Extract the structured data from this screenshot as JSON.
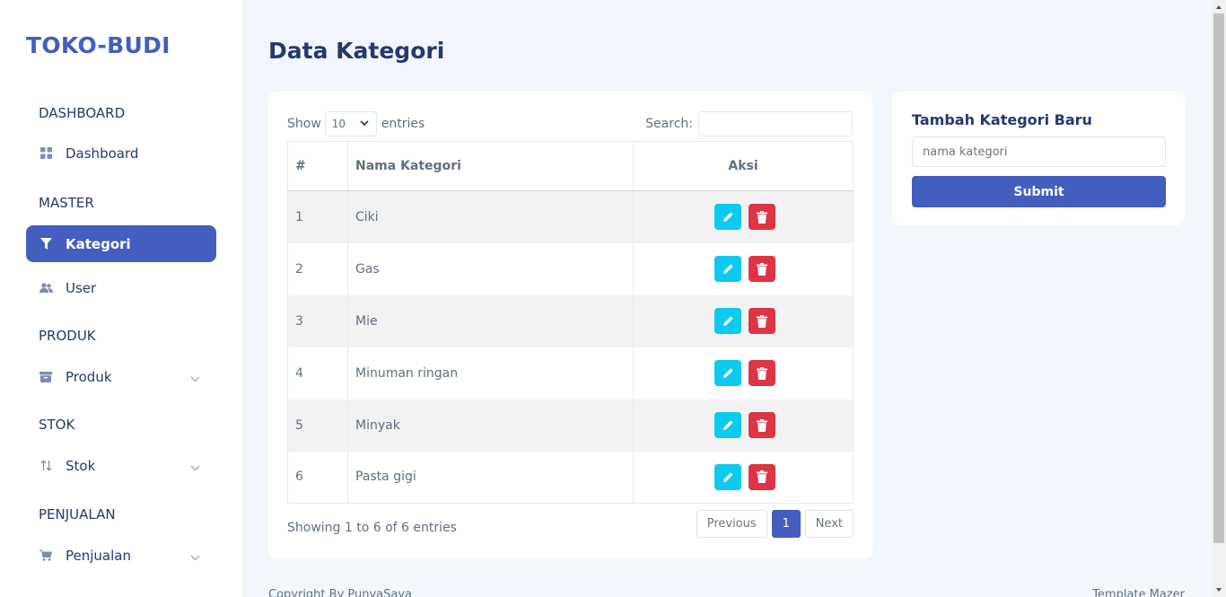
{
  "brand": "TOKO-BUDI",
  "page_title": "Data Kategori",
  "sidebar": {
    "sections": [
      {
        "title": "DASHBOARD"
      },
      {
        "title": "MASTER"
      },
      {
        "title": "PRODUK"
      },
      {
        "title": "STOK"
      },
      {
        "title": "PENJUALAN"
      }
    ],
    "items": [
      {
        "label": "Dashboard",
        "icon": "grid-icon",
        "active": false
      },
      {
        "label": "Kategori",
        "icon": "filter-icon",
        "active": true
      },
      {
        "label": "User",
        "icon": "users-icon",
        "active": false
      },
      {
        "label": "Produk",
        "icon": "archive-icon",
        "active": false,
        "has_submenu": true
      },
      {
        "label": "Stok",
        "icon": "sort-arrows-icon",
        "active": false,
        "has_submenu": true
      },
      {
        "label": "Penjualan",
        "icon": "cart-icon",
        "active": false,
        "has_submenu": true
      }
    ]
  },
  "table": {
    "show_label": "Show",
    "entries_value": "10",
    "entries_label": "entries",
    "search_label": "Search:",
    "columns": [
      "#",
      "Nama Kategori",
      "Aksi"
    ],
    "rows": [
      {
        "no": "1",
        "nama": "Ciki"
      },
      {
        "no": "2",
        "nama": "Gas"
      },
      {
        "no": "3",
        "nama": "Mie"
      },
      {
        "no": "4",
        "nama": "Minuman ringan"
      },
      {
        "no": "5",
        "nama": "Minyak"
      },
      {
        "no": "6",
        "nama": "Pasta gigi"
      }
    ],
    "info": "Showing 1 to 6 of 6 entries",
    "pagination": {
      "previous": "Previous",
      "current": "1",
      "next": "Next"
    }
  },
  "form": {
    "title": "Tambah Kategori Baru",
    "placeholder": "nama kategori",
    "submit_label": "Submit"
  },
  "footer": {
    "left": "Copyright By PunyaSaya",
    "right": "Template Mazer"
  },
  "colors": {
    "primary": "#435ebe",
    "edit": "#0dcaf0",
    "delete": "#dc3545",
    "background": "#f2f7ff"
  }
}
